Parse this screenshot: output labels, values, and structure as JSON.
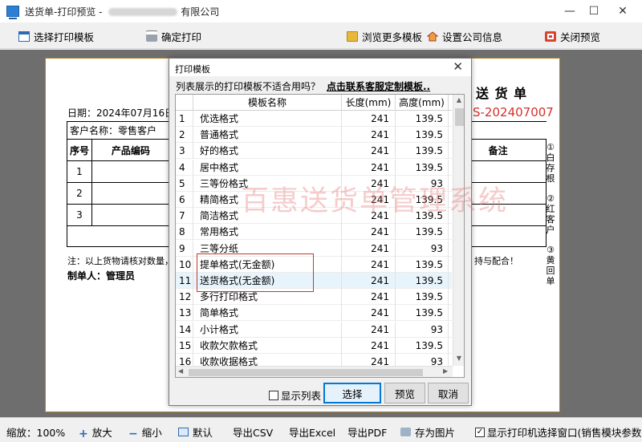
{
  "window": {
    "title_prefix": "送货单-打印预览 - ",
    "title_suffix": "有限公司",
    "minimize": "—",
    "maximize": "☐",
    "close": "✕"
  },
  "toolbar": {
    "select_template": "选择打印模板",
    "confirm_print": "确定打印",
    "browse_more": "浏览更多模板",
    "company_info": "设置公司信息",
    "close_preview": "关闭预览"
  },
  "document": {
    "title": "送 货 单",
    "number": "S-202407007",
    "date": "日期：2024年07月16日",
    "customer": "客户名称：零售客户",
    "col_seq": "序号",
    "col_code": "产品编码",
    "col_remark": "备注",
    "rows": [
      "1",
      "2",
      "3"
    ],
    "note_left": "注：以上货物请核对数量，",
    "note_right": "持与配合！",
    "maker": "制单人：管理员",
    "side_copies": [
      "①白存根",
      "②红客户",
      "③黄回单"
    ]
  },
  "watermark": "百惠送货单管理系统",
  "dialog": {
    "title": "打印模板",
    "close": "✕",
    "prompt": "列表展示的打印模板不适合用吗？",
    "link": "点击联系客服定制模板..",
    "columns": [
      "",
      "模板名称",
      "长度(mm)",
      "高度(mm)"
    ],
    "rows": [
      {
        "no": "1",
        "name": "优选格式",
        "length": "241",
        "height": "139.5"
      },
      {
        "no": "2",
        "name": "普通格式",
        "length": "241",
        "height": "139.5"
      },
      {
        "no": "3",
        "name": "好的格式",
        "length": "241",
        "height": "139.5"
      },
      {
        "no": "4",
        "name": "居中格式",
        "length": "241",
        "height": "139.5"
      },
      {
        "no": "5",
        "name": "三等份格式",
        "length": "241",
        "height": "93"
      },
      {
        "no": "6",
        "name": "精简格式",
        "length": "241",
        "height": "139.5"
      },
      {
        "no": "7",
        "name": "简洁格式",
        "length": "241",
        "height": "139.5"
      },
      {
        "no": "8",
        "name": "常用格式",
        "length": "241",
        "height": "139.5"
      },
      {
        "no": "9",
        "name": "三等分纸",
        "length": "241",
        "height": "93"
      },
      {
        "no": "10",
        "name": "提单格式(无金额)",
        "length": "241",
        "height": "139.5"
      },
      {
        "no": "11",
        "name": "送货格式(无金额)",
        "length": "241",
        "height": "139.5"
      },
      {
        "no": "12",
        "name": "多行打印格式",
        "length": "241",
        "height": "139.5"
      },
      {
        "no": "13",
        "name": "简单格式",
        "length": "241",
        "height": "139.5"
      },
      {
        "no": "14",
        "name": "小计格式",
        "length": "241",
        "height": "93"
      },
      {
        "no": "15",
        "name": "收款欠款格式",
        "length": "241",
        "height": "139.5"
      },
      {
        "no": "16",
        "name": "收款收据格式",
        "length": "241",
        "height": "93"
      }
    ],
    "show_list": "显示列表",
    "select": "选择",
    "preview": "预览",
    "cancel": "取消"
  },
  "statusbar": {
    "zoom": "缩放：100%",
    "zoom_in": "放大",
    "zoom_out": "缩小",
    "default": "默认",
    "export_csv": "导出CSV",
    "export_excel": "导出Excel",
    "export_pdf": "导出PDF",
    "save_image": "存为图片",
    "show_printer": "显示打印机选择窗口(销售模块参数)"
  },
  "colors": {
    "accent_red": "#c0392b",
    "doc_number_red": "#d4302b",
    "selected_row": "#e8f4fc",
    "preview_bg": "#6e6e6e"
  }
}
